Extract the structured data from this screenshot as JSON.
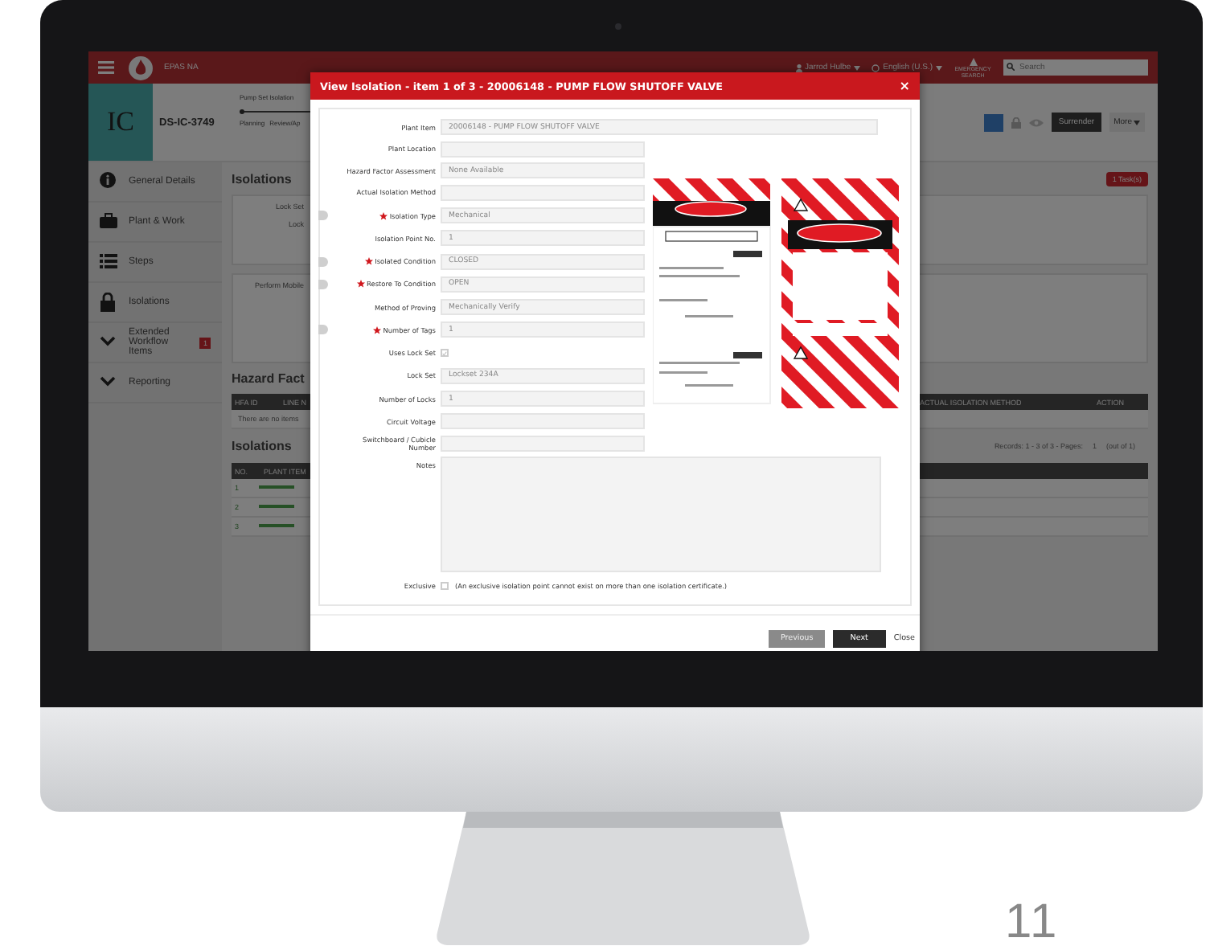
{
  "top_bar": {
    "app_name": "EPAS NA",
    "user": "Jarrod Hulbe",
    "language": "English (U.S.)",
    "emergency": "EMERGENCY SEARCH",
    "search": {
      "placeholder": "Search"
    }
  },
  "record": {
    "type_code": "IC",
    "id": "DS-IC-3749",
    "workflow": "Pump Set Isolation",
    "steps": [
      {
        "label": "Planning"
      },
      {
        "label": "Review/Ap"
      }
    ]
  },
  "toolbar": {
    "buttons": [
      {
        "label": "Surrender",
        "kind": "dark"
      },
      {
        "label": "More",
        "kind": "menu"
      }
    ]
  },
  "sidebar": {
    "items": [
      {
        "label": "General Details",
        "kind": "info"
      },
      {
        "label": "Plant & Work",
        "kind": "briefcase"
      },
      {
        "label": "Steps",
        "kind": "list"
      },
      {
        "label": "Isolations",
        "kind": "lock"
      },
      {
        "label": "Extended Workflow Items",
        "kind": "chevron",
        "badge": "1"
      },
      {
        "label": "Reporting",
        "kind": "chevron"
      }
    ]
  },
  "main": {
    "heading": "Isolations",
    "task_badge": "1 Task(s)",
    "lock_card": [
      "Lock Set",
      "Lock"
    ],
    "steps_card": [
      "Perform Mobile"
    ],
    "hazard": {
      "heading": "Hazard Fact",
      "columns": [
        "HFA ID",
        "LINE N",
        "ACTUAL ISOLATION METHOD",
        "ACTION"
      ],
      "empty": "There are no items"
    },
    "isolations": {
      "heading": "Isolations",
      "records": "Records: 1 - 3 of 3 - Pages:",
      "page": "1",
      "out_of": "(out of 1)",
      "columns": [
        "NO.",
        "PLANT ITEM"
      ],
      "rows": [
        "1",
        "2",
        "3"
      ]
    }
  },
  "modal": {
    "title": "View Isolation - item 1 of 3 - 20006148 - PUMP FLOW SHUTOFF VALVE",
    "close": "×",
    "fields": [
      {
        "label": "Plant Item",
        "kind": "wide",
        "value": "20006148 - PUMP FLOW SHUTOFF VALVE",
        "required": false
      },
      {
        "label": "Plant Location",
        "kind": "text",
        "required": false
      },
      {
        "label": "Hazard Factor Assessment",
        "kind": "text",
        "value": "None Available",
        "required": false
      },
      {
        "label": "Actual Isolation Method",
        "kind": "text",
        "required": false
      },
      {
        "label": "Isolation Type",
        "kind": "text",
        "value": "Mechanical",
        "required": true
      },
      {
        "label": "Isolation Point No.",
        "kind": "text",
        "value": "1",
        "required": false
      },
      {
        "label": "Isolated Condition",
        "kind": "text",
        "value": "CLOSED",
        "required": true
      },
      {
        "label": "Restore To Condition",
        "kind": "text",
        "value": "OPEN",
        "required": true
      },
      {
        "label": "Method of Proving",
        "kind": "text",
        "value": "Mechanically Verify",
        "required": false
      },
      {
        "label": "Number of Tags",
        "kind": "text",
        "value": "1",
        "required": true
      },
      {
        "label": "Uses Lock Set",
        "kind": "checkbox",
        "checked": true,
        "required": false
      },
      {
        "label": "Lock Set",
        "kind": "text",
        "value": "Lockset 234A",
        "required": false
      },
      {
        "label": "Number of Locks",
        "kind": "text",
        "value": "1",
        "required": false
      },
      {
        "label": "Circuit Voltage",
        "kind": "text",
        "required": false
      },
      {
        "label": "Switchboard / Cubicle Number",
        "kind": "text",
        "required": false
      },
      {
        "label": "Notes",
        "kind": "textarea",
        "required": false
      }
    ],
    "exclusive": {
      "label": "Exclusive",
      "checked": false,
      "hint": "(An exclusive isolation point cannot exist on more than one isolation certificate.)"
    },
    "buttons": [
      {
        "label": "Previous",
        "kind": "secondary"
      },
      {
        "label": "Next",
        "kind": "primary"
      },
      {
        "label": "Close",
        "kind": "link"
      }
    ]
  },
  "page_number": "11"
}
